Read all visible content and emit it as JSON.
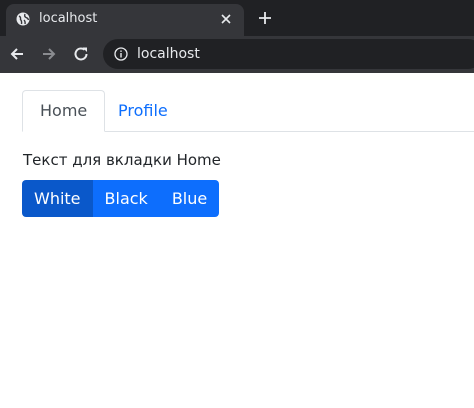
{
  "browser": {
    "tab_title": "localhost",
    "url": "localhost",
    "icons": [
      "globe-icon",
      "close-icon",
      "plus-icon",
      "back-arrow-icon",
      "forward-arrow-icon",
      "reload-icon",
      "info-icon"
    ]
  },
  "page": {
    "tabs": [
      {
        "label": "Home",
        "active": true
      },
      {
        "label": "Profile",
        "active": false
      }
    ],
    "pane_text": "Текст для вкладки Home",
    "buttons": [
      {
        "label": "White",
        "active": true
      },
      {
        "label": "Black",
        "active": false
      },
      {
        "label": "Blue",
        "active": false
      }
    ],
    "colors": {
      "primary": "#0d6efd",
      "primary_active": "#0a58ca",
      "chrome_dark": "#202124",
      "chrome_tab": "#35363a"
    }
  }
}
